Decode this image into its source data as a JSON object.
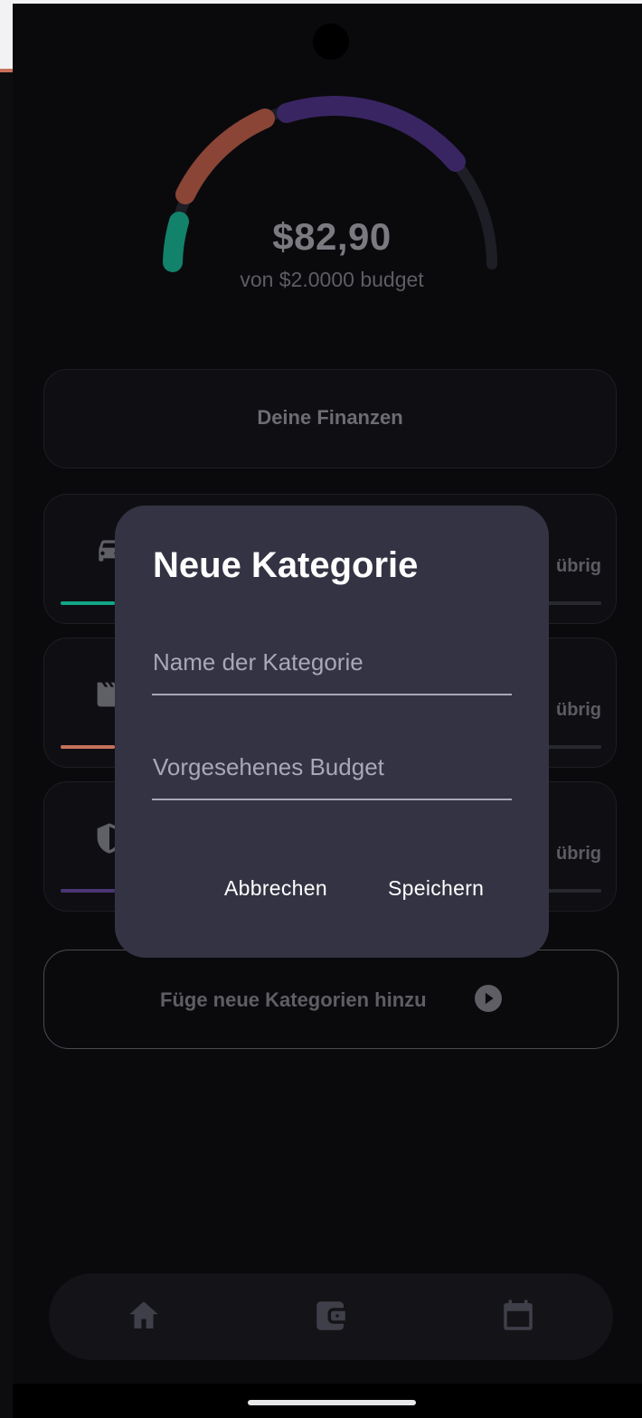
{
  "gauge": {
    "amount": "$82,90",
    "budget_text": "von $2.0000 budget",
    "colors": {
      "segment1": "#13826a",
      "segment2": "#8a4536",
      "segment3": "#3a2563",
      "track": "#1e1e26"
    }
  },
  "finanzen_card": {
    "label": "Deine Finanzen"
  },
  "categories": [
    {
      "icon": "car-icon",
      "remaining_label": "übrig",
      "accent": "#12a588",
      "progress": 0.1
    },
    {
      "icon": "clapperboard-icon",
      "remaining_label": "übrig",
      "accent": "#c7705b",
      "progress": 0.1
    },
    {
      "icon": "shield-icon",
      "remaining_label": "übrig",
      "accent": "#4a3575",
      "progress": 0.1
    }
  ],
  "add_category": {
    "label": "Füge neue Kategorien hinzu",
    "icon": "play-circle-icon"
  },
  "bottom_nav": [
    {
      "icon": "home-icon"
    },
    {
      "icon": "wallet-icon"
    },
    {
      "icon": "calendar-icon"
    }
  ],
  "dialog": {
    "title": "Neue Kategorie",
    "name_placeholder": "Name der Kategorie",
    "name_value": "",
    "budget_placeholder": "Vorgesehenes Budget",
    "budget_value": "",
    "cancel_label": "Abbrechen",
    "save_label": "Speichern",
    "background": "#343343"
  }
}
